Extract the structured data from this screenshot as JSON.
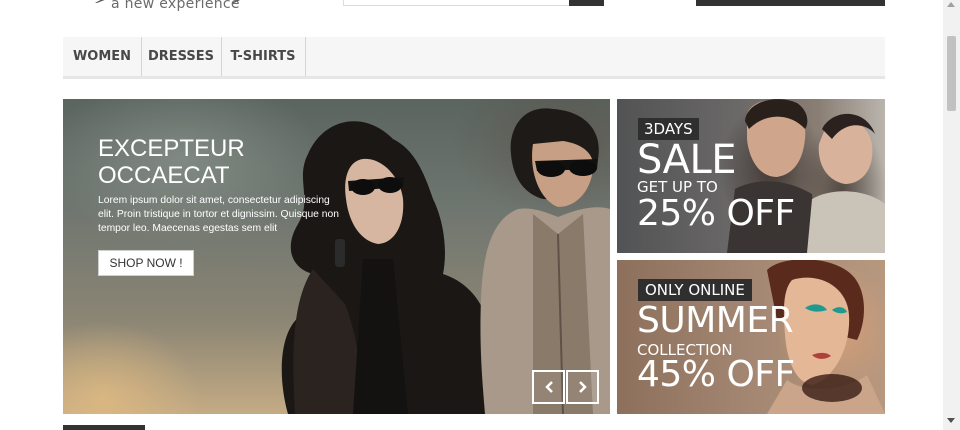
{
  "header": {
    "tagline": "a new experience"
  },
  "nav": {
    "items": [
      {
        "label": "WOMEN"
      },
      {
        "label": "DRESSES"
      },
      {
        "label": "T-SHIRTS"
      }
    ]
  },
  "slider": {
    "title": "EXCEPTEUR OCCAECAT",
    "text": "Lorem ipsum dolor sit amet, consectetur adipiscing elit. Proin tristique in tortor et dignissim. Quisque non tempor leo. Maecenas egestas sem elit",
    "button_label": "SHOP NOW !",
    "prev_icon": "chevron-left-icon",
    "next_icon": "chevron-right-icon"
  },
  "banners": {
    "top": {
      "tag": "3DAYS",
      "headline": "SALE",
      "subline": "GET UP TO",
      "offer": "25% OFF"
    },
    "bottom": {
      "tag": "ONLY ONLINE",
      "headline": "SUMMER",
      "subline": "COLLECTION",
      "offer": "45% OFF"
    }
  },
  "colors": {
    "nav_background": "#f6f6f6",
    "tag_background": "#2f2f2f",
    "dark_bar": "#333333"
  }
}
